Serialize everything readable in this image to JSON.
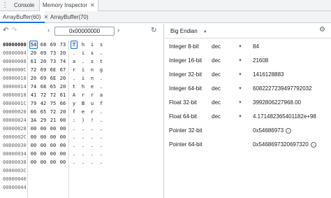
{
  "topbar": {
    "tabs": [
      {
        "label": "Console"
      },
      {
        "label": "Memory Inspector",
        "close": "✕"
      }
    ]
  },
  "buffer_tabs": [
    {
      "label": "ArrayBuffer(60)",
      "close": "✕"
    },
    {
      "label": "ArrayBuffer(70)"
    }
  ],
  "nav": {
    "address": "0x00000000"
  },
  "memory": {
    "rows": [
      {
        "offset": "00000000",
        "bytes": [
          "54",
          "68",
          "69",
          "73"
        ],
        "chars": [
          "T",
          "h",
          "i",
          "s"
        ]
      },
      {
        "offset": "00000004",
        "bytes": [
          "20",
          "69",
          "73",
          "20"
        ],
        "chars": [
          ".",
          "i",
          "s",
          "."
        ]
      },
      {
        "offset": "00000008",
        "bytes": [
          "61",
          "20",
          "73",
          "74"
        ],
        "chars": [
          "a",
          ".",
          "s",
          "t"
        ]
      },
      {
        "offset": "0000000C",
        "bytes": [
          "72",
          "69",
          "6E",
          "67"
        ],
        "chars": [
          "r",
          "i",
          "n",
          "g"
        ]
      },
      {
        "offset": "00000010",
        "bytes": [
          "20",
          "69",
          "6E",
          "20"
        ],
        "chars": [
          ".",
          "i",
          "n",
          "."
        ]
      },
      {
        "offset": "00000014",
        "bytes": [
          "74",
          "68",
          "65",
          "20"
        ],
        "chars": [
          "t",
          "h",
          "e",
          "."
        ]
      },
      {
        "offset": "00000018",
        "bytes": [
          "41",
          "72",
          "72",
          "61"
        ],
        "chars": [
          "A",
          "r",
          "r",
          "a"
        ]
      },
      {
        "offset": "0000001C",
        "bytes": [
          "79",
          "42",
          "75",
          "66"
        ],
        "chars": [
          "y",
          "B",
          "u",
          "f"
        ]
      },
      {
        "offset": "00000020",
        "bytes": [
          "66",
          "65",
          "72",
          "20"
        ],
        "chars": [
          "f",
          "e",
          "r",
          "."
        ]
      },
      {
        "offset": "00000024",
        "bytes": [
          "3A",
          "29",
          "21",
          "00"
        ],
        "chars": [
          ":",
          ")",
          "!",
          "."
        ]
      },
      {
        "offset": "00000028",
        "bytes": [
          "00",
          "00",
          "00",
          "00"
        ],
        "chars": [
          ".",
          ".",
          ".",
          "."
        ]
      },
      {
        "offset": "0000002C",
        "bytes": [
          "00",
          "00",
          "00",
          "00"
        ],
        "chars": [
          ".",
          ".",
          ".",
          "."
        ]
      },
      {
        "offset": "00000030",
        "bytes": [
          "00",
          "00",
          "00",
          "00"
        ],
        "chars": [
          ".",
          ".",
          ".",
          "."
        ]
      },
      {
        "offset": "00000034",
        "bytes": [
          "00",
          "00",
          "00",
          "00"
        ],
        "chars": [
          ".",
          ".",
          ".",
          "."
        ]
      },
      {
        "offset": "00000038",
        "bytes": [
          "00",
          "00",
          "00",
          "00"
        ],
        "chars": [
          ".",
          ".",
          ".",
          "."
        ]
      },
      {
        "offset": "0000003C",
        "bytes": [],
        "chars": []
      },
      {
        "offset": "00000040",
        "bytes": [],
        "chars": []
      },
      {
        "offset": "00000044",
        "bytes": [],
        "chars": []
      }
    ]
  },
  "inspector": {
    "endianness": "Big Endian",
    "values": [
      {
        "name": "Integer 8-bit",
        "mode": "dec",
        "value": "84"
      },
      {
        "name": "Integer 16-bit",
        "mode": "dec",
        "value": "21608"
      },
      {
        "name": "Integer 32-bit",
        "mode": "dec",
        "value": "1416128883"
      },
      {
        "name": "Integer 64-bit",
        "mode": "dec",
        "value": "6082227239497792032"
      },
      {
        "name": "Float 32-bit",
        "mode": "dec",
        "value": "3992806227968.00"
      },
      {
        "name": "Float 64-bit",
        "mode": "dec",
        "value": "4.171482365401182e+98"
      },
      {
        "name": "Pointer 32-bit",
        "mode": "",
        "value": "0x54686973"
      },
      {
        "name": "Pointer 64-bit",
        "mode": "",
        "value": "0x5468697320697320"
      }
    ]
  }
}
